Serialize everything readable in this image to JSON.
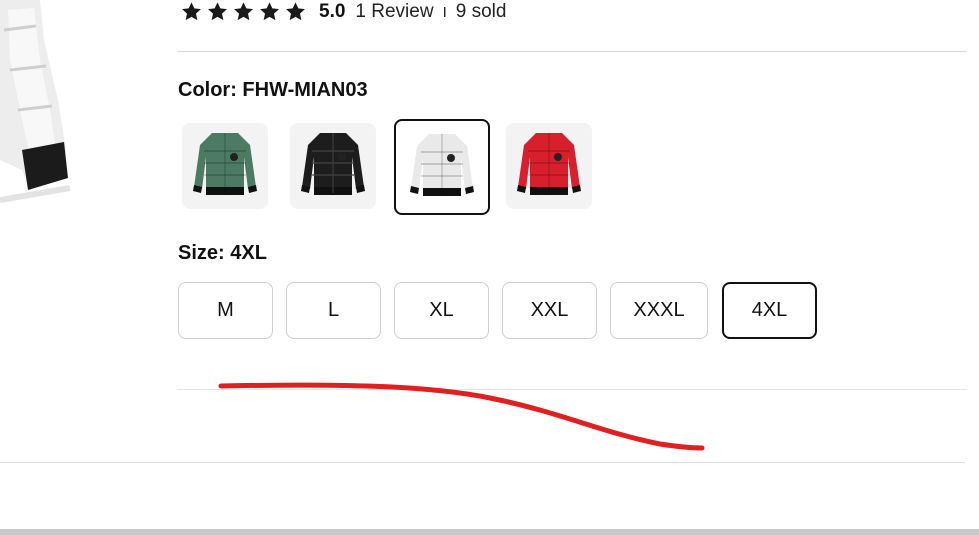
{
  "rating": {
    "stars": 5,
    "score": "5.0",
    "review_text": "1 Review",
    "separator": "I",
    "sold_text": "9 sold"
  },
  "color": {
    "label": "Color: FHW-MIAN03",
    "selected_index": 2,
    "options": [
      {
        "name": "green",
        "hex": "#4d7a63",
        "icon": "jacket-green-icon"
      },
      {
        "name": "black",
        "hex": "#1d1d1d",
        "icon": "jacket-black-icon"
      },
      {
        "name": "white",
        "hex": "#e9e9e9",
        "icon": "jacket-white-icon"
      },
      {
        "name": "red",
        "hex": "#d81f2c",
        "icon": "jacket-red-icon"
      }
    ]
  },
  "size": {
    "label": "Size: 4XL",
    "selected": "4XL",
    "options": [
      "M",
      "L",
      "XL",
      "XXL",
      "XXXL",
      "4XL"
    ]
  },
  "colors": {
    "selected_border": "#111111",
    "annotation_stroke": "#e02020",
    "divider": "#dcdcdc"
  }
}
